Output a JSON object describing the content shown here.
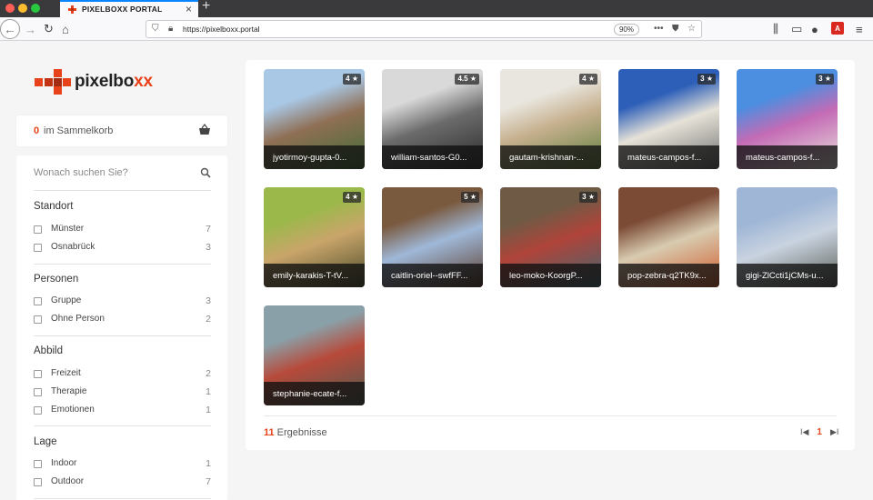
{
  "browser": {
    "tab_title": "PIXELBOXX PORTAL",
    "tab_close": "×",
    "new_tab": "+",
    "url": "https://pixelboxx.portal",
    "zoom": "90%",
    "pdf_label": "A"
  },
  "brand": {
    "name_prefix": "pixelbo",
    "name_accent": "xx",
    "accent_color": "#e8421a"
  },
  "cart": {
    "count": "0",
    "label": "im Sammelkorb"
  },
  "search": {
    "placeholder": "Wonach suchen Sie?"
  },
  "filters": [
    {
      "title": "Standort",
      "options": [
        {
          "label": "Münster",
          "count": "7"
        },
        {
          "label": "Osnabrück",
          "count": "3"
        }
      ]
    },
    {
      "title": "Personen",
      "options": [
        {
          "label": "Gruppe",
          "count": "3"
        },
        {
          "label": "Ohne Person",
          "count": "2"
        }
      ]
    },
    {
      "title": "Abbild",
      "options": [
        {
          "label": "Freizeit",
          "count": "2"
        },
        {
          "label": "Therapie",
          "count": "1"
        },
        {
          "label": "Emotionen",
          "count": "1"
        }
      ]
    },
    {
      "title": "Lage",
      "options": [
        {
          "label": "Indoor",
          "count": "1"
        },
        {
          "label": "Outdoor",
          "count": "7"
        }
      ]
    }
  ],
  "results": {
    "items": [
      {
        "caption": "jyotirmoy-gupta-0...",
        "rating": "4 ★",
        "colors": [
          "#a9c8e6",
          "#8f6f55",
          "#3f6b34"
        ]
      },
      {
        "caption": "william-santos-G0...",
        "rating": "4.5 ★",
        "colors": [
          "#d9d9d9",
          "#6b6b6b",
          "#2a2a2a"
        ]
      },
      {
        "caption": "gautam-krishnan-...",
        "rating": "4 ★",
        "colors": [
          "#e9e6df",
          "#c6b08e",
          "#5d7d3c"
        ]
      },
      {
        "caption": "mateus-campos-f...",
        "rating": "3 ★",
        "colors": [
          "#2d5fb8",
          "#e6e2d8",
          "#6f6f6f"
        ]
      },
      {
        "caption": "mateus-campos-f...",
        "rating": "3 ★",
        "colors": [
          "#4c8ee0",
          "#c46bb5",
          "#e8e3dc"
        ]
      },
      {
        "caption": "emily-karakis-T-tV...",
        "rating": "4 ★",
        "colors": [
          "#9bb84a",
          "#c9a56a",
          "#4a4a2a"
        ]
      },
      {
        "caption": "caitlin-oriel--swfFF...",
        "rating": "5 ★",
        "colors": [
          "#7a5a3f",
          "#9fb8d8",
          "#5b3b2a"
        ]
      },
      {
        "caption": "leo-moko-KoorgP...",
        "rating": "3 ★",
        "colors": [
          "#6f5a45",
          "#b0443a",
          "#3d6570"
        ]
      },
      {
        "caption": "pop-zebra-q2TK9x...",
        "rating": "",
        "colors": [
          "#7c4b36",
          "#d8cbb0",
          "#cf5a2a"
        ]
      },
      {
        "caption": "gigi-ZlCcti1jCMs-u...",
        "rating": "",
        "colors": [
          "#9fb6d6",
          "#c9d3e0",
          "#5a5e55"
        ]
      },
      {
        "caption": "stephanie-ecate-f...",
        "rating": "",
        "colors": [
          "#8aa0a8",
          "#b74a3a",
          "#4b5a50"
        ]
      }
    ],
    "count": "11",
    "label": "Ergebnisse",
    "page": "1",
    "first_icon": "I◀",
    "next_icon": "▶I"
  }
}
